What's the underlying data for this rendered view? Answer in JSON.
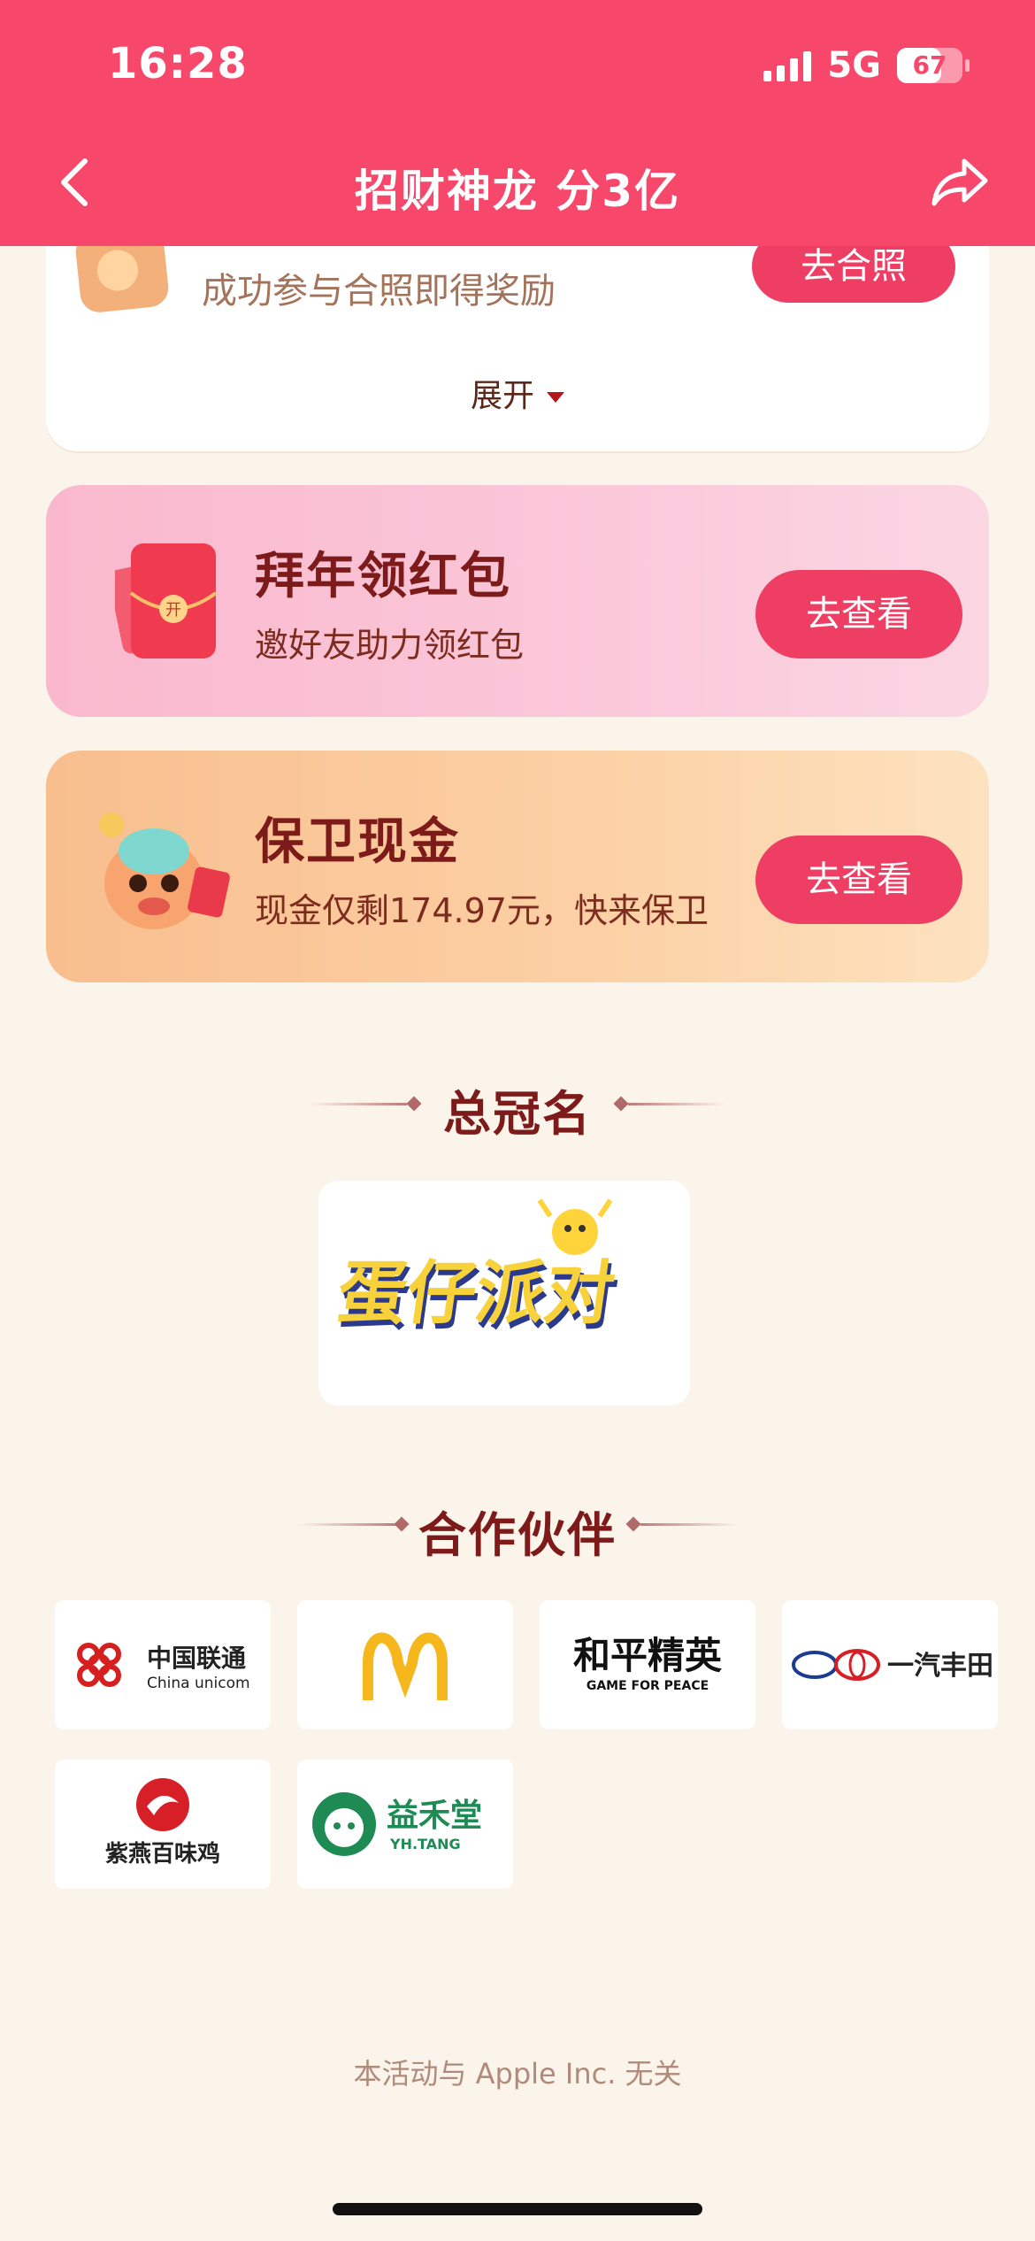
{
  "status_bar": {
    "time": "16:28",
    "network": "5G",
    "battery": "67"
  },
  "nav": {
    "title": "招财神龙 分3亿"
  },
  "card_photo": {
    "description": "成功参与合照即得奖励",
    "button_label": "去合照",
    "expand_label": "展开"
  },
  "promos": [
    {
      "title": "拜年领红包",
      "subtitle": "邀好友助力领红包",
      "button_label": "去查看"
    },
    {
      "title": "保卫现金",
      "subtitle": "现金仅剩174.97元，快来保卫",
      "button_label": "去查看"
    }
  ],
  "sponsor_section": {
    "title": "总冠名",
    "sponsor_name": "蛋仔派对"
  },
  "partner_section": {
    "title": "合作伙伴",
    "partners": [
      {
        "name": "中国联通",
        "sub": "China unicom"
      },
      {
        "name": "McDonald's"
      },
      {
        "name": "和平精英",
        "sub": "GAME FOR PEACE"
      },
      {
        "name": "一汽丰田"
      },
      {
        "name": "紫燕百味鸡"
      },
      {
        "name": "益禾堂",
        "sub": "YH.TANG"
      }
    ]
  },
  "footer": {
    "disclaimer": "本活动与 Apple Inc. 无关"
  },
  "colors": {
    "header": "#f7476a",
    "button": "#ef3e63",
    "title": "#7d1b1b",
    "background": "#fbf4ea"
  }
}
